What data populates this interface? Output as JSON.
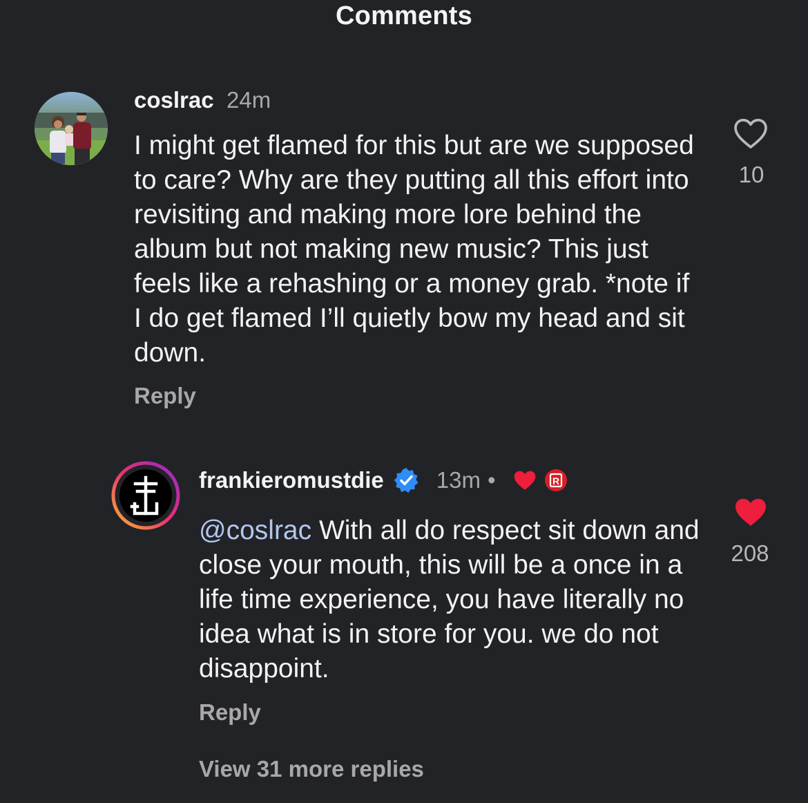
{
  "header": {
    "title": "Comments"
  },
  "comments": [
    {
      "username": "coslrac",
      "time": "24m",
      "text": "I might get flamed for this but are we supposed to care? Why are they putting all this effort into revisiting and making more lore behind the album but not making new music? This just feels like a rehashing or a money grab. *note if I do get flamed I’ll quietly bow my head and sit down.",
      "reply_label": "Reply",
      "like_count": "10",
      "liked": false,
      "avatar_icon": "profile-photo"
    }
  ],
  "reply": {
    "username": "frankieromustdie",
    "verified_icon": "verified-badge-icon",
    "time": "13m",
    "separator": "•",
    "creator_liked_icon": "heart-icon",
    "badge_icon": "r-badge-icon",
    "badge_letter": "R",
    "mention": "@coslrac",
    "text": " With all do respect sit down and close your mouth, this will be a once in a life time experience, you have literally no idea what is in store for you. we do not disappoint.",
    "reply_label": "Reply",
    "like_count": "208",
    "liked": true,
    "avatar_icon": "cross-anchor-logo"
  },
  "view_more_replies": "View 31 more replies",
  "colors": {
    "background": "#222327",
    "text": "#f3f3f3",
    "muted": "#a8a8a8",
    "mention": "#b3c6ee",
    "like_red": "#ee1e3c",
    "verified_blue": "#2f8df5"
  }
}
